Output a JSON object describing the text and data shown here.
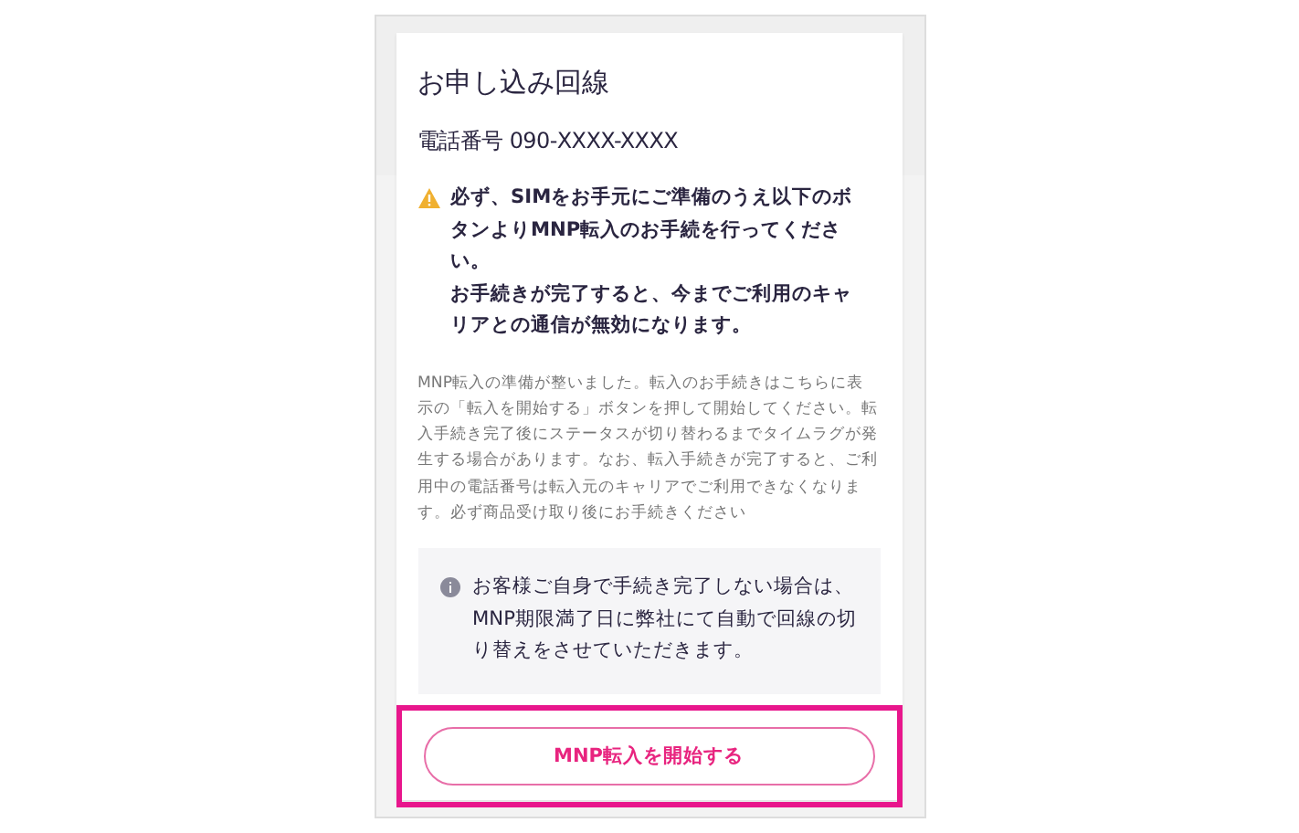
{
  "title": "お申し込み回線",
  "phone": {
    "label": "電話番号",
    "value": "090-XXXX-XXXX"
  },
  "warning": {
    "lines": [
      "必ず、SIMをお手元にご準備のうえ以下のボタンよりMNP転入のお手続を行ってください。",
      "お手続きが完了すると、今までご利用のキャリアとの通信が無効になります。"
    ]
  },
  "description": "MNP転入の準備が整いました。転入のお手続きはこちらに表示の「転入を開始する」ボタンを押して開始してください。転入手続き完了後にステータスが切り替わるまでタイムラグが発生する場合があります。なお、転入手続きが完了すると、ご利用中の電話番号は転入元のキャリアでご利用できなくなります。必ず商品受け取り後にお手続きください",
  "info": "お客様ご自身で手続き完了しない場合は、MNP期限満了日に弊社にて自動で回線の切り替えをさせていただきます。",
  "button": {
    "label": "MNP転入を開始する",
    "highlighted": true
  }
}
